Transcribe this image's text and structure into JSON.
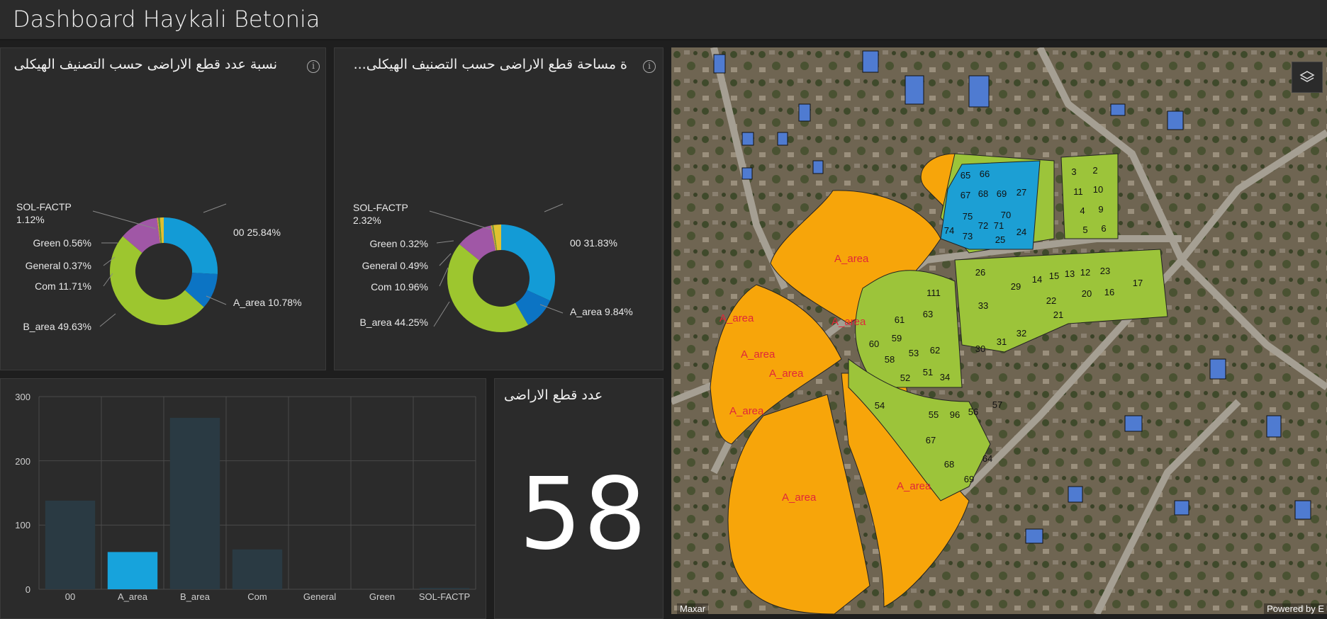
{
  "header": {
    "title": "Dashboard Haykali Betonia"
  },
  "panels": {
    "count_pie": {
      "title": "نسبة عدد قطع الاراضى حسب التصنيف الهيكلى",
      "info": "i",
      "labels": {
        "sol_factp": "SOL-FACTP",
        "sol_factp_pct": "1.12%",
        "green": "Green 0.56%",
        "general": "General 0.37%",
        "com": "Com 11.71%",
        "b_area": "B_area 49.63%",
        "zero_zero": "00 25.84%",
        "a_area": "A_area 10.78%"
      }
    },
    "area_pie": {
      "title": "...ة مساحة قطع الاراضى حسب التصنيف الهيكلى",
      "info": "i",
      "labels": {
        "sol_factp": "SOL-FACTP",
        "sol_factp_pct": "2.32%",
        "green": "Green 0.32%",
        "general": "General 0.49%",
        "com": "Com 10.96%",
        "b_area": "B_area 44.25%",
        "zero_zero": "00 31.83%",
        "a_area": "A_area 9.84%"
      }
    },
    "bar": {
      "yticks": [
        "300",
        "200",
        "100",
        "0"
      ]
    },
    "indicator": {
      "title": "عدد قطع الاراضى",
      "value": "58"
    }
  },
  "chart_data": [
    {
      "type": "pie",
      "title": "نسبة عدد قطع الاراضى حسب التصنيف الهيكلى",
      "donut": true,
      "categories": [
        "00",
        "A_area",
        "B_area",
        "Com",
        "General",
        "Green",
        "SOL-FACTP"
      ],
      "values": [
        25.84,
        10.78,
        49.63,
        11.71,
        0.37,
        0.56,
        1.12
      ],
      "unit": "%"
    },
    {
      "type": "pie",
      "title": "...ة مساحة قطع الاراضى حسب التصنيف الهيكلى",
      "donut": true,
      "categories": [
        "00",
        "A_area",
        "B_area",
        "Com",
        "General",
        "Green",
        "SOL-FACTP"
      ],
      "values": [
        31.83,
        9.84,
        44.25,
        10.96,
        0.49,
        0.32,
        2.32
      ],
      "unit": "%"
    },
    {
      "type": "bar",
      "categories": [
        "00",
        "A_area",
        "B_area",
        "Com",
        "General",
        "Green",
        "SOL-FACTP"
      ],
      "values": [
        138,
        58,
        267,
        62,
        0,
        0,
        2
      ],
      "ylim": [
        0,
        300
      ],
      "grid": true,
      "highlighted": "A_area"
    }
  ],
  "colors": {
    "zero_zero": "#139bd6",
    "a_area": "#0c74c4",
    "b_area": "#9dc62f",
    "com": "#a057a6",
    "general": "#d9a440",
    "green": "#5a9a3a",
    "sol_factp": "#e0c030",
    "bar_default": "#2a3a43",
    "bar_highlight": "#17a3dc",
    "parcel_orange": "#f7a50a",
    "parcel_green": "#9cc43a",
    "parcel_blue": "#1c9fd4",
    "building_blue": "#4f7bd1"
  },
  "map": {
    "attribution_left": "Maxar",
    "attribution_right": "Powered by E",
    "layers_icon": "layers-icon",
    "zone_labels": [
      "A_area",
      "A_area",
      "A_area",
      "A_area",
      "A_area",
      "A_area",
      "A_area",
      "A_area"
    ],
    "parcel_numbers": [
      "65",
      "66",
      "67",
      "68",
      "69",
      "27",
      "75",
      "70",
      "74",
      "73",
      "72",
      "71",
      "25",
      "24",
      "3",
      "2",
      "11",
      "10",
      "4",
      "9",
      "5",
      "6",
      "111",
      "26",
      "29",
      "14",
      "15",
      "13",
      "12",
      "23",
      "17",
      "61",
      "63",
      "33",
      "22",
      "20",
      "16",
      "60",
      "59",
      "21",
      "58",
      "53",
      "62",
      "30",
      "31",
      "32",
      "52",
      "51",
      "34",
      "54",
      "55",
      "96",
      "56",
      "57",
      "67",
      "68",
      "64",
      "69"
    ]
  }
}
